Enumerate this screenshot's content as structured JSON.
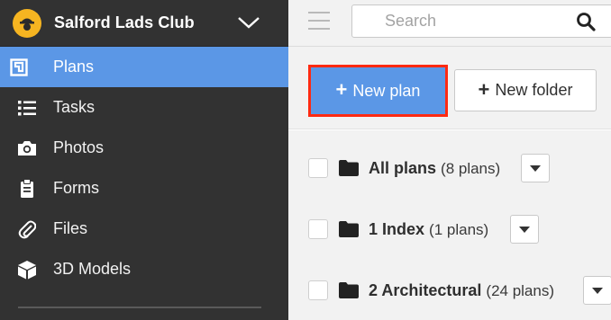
{
  "sidebar": {
    "club_name": "Salford Lads Club",
    "items": [
      {
        "label": "Plans",
        "icon": "plans-icon",
        "active": true
      },
      {
        "label": "Tasks",
        "icon": "list-icon",
        "active": false
      },
      {
        "label": "Photos",
        "icon": "camera-icon",
        "active": false
      },
      {
        "label": "Forms",
        "icon": "clipboard-icon",
        "active": false
      },
      {
        "label": "Files",
        "icon": "paperclip-icon",
        "active": false
      },
      {
        "label": "3D Models",
        "icon": "cube-icon",
        "active": false
      }
    ]
  },
  "topbar": {
    "search_placeholder": "Search"
  },
  "actions": {
    "new_plan": "New plan",
    "new_folder": "New folder"
  },
  "plans": [
    {
      "name": "All plans",
      "count": "(8 plans)"
    },
    {
      "name": "1 Index",
      "count": "(1 plans)"
    },
    {
      "name": "2 Architectural",
      "count": "(24 plans)"
    }
  ],
  "colors": {
    "sidebar_bg": "#323232",
    "accent": "#5b97e6",
    "highlight_border": "#ff2a12",
    "logo": "#f6b521"
  }
}
